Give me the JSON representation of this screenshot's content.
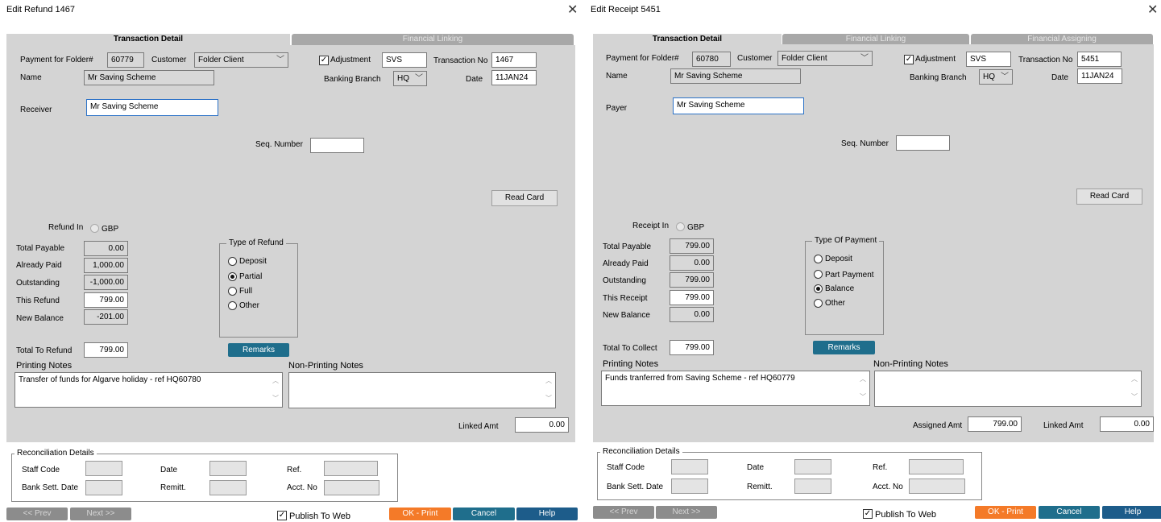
{
  "refund": {
    "title": "Edit Refund 1467",
    "tabs": [
      "Transaction Detail",
      "Financial Linking"
    ],
    "payment_for_folder_label": "Payment for Folder#",
    "folder_no": "60779",
    "customer_label": "Customer",
    "customer_value": "Folder Client",
    "adjustment_label": "Adjustment",
    "adjustment_code": "SVS",
    "transaction_no_label": "Transaction No",
    "transaction_no": "1467",
    "name_label": "Name",
    "name_value": "Mr Saving Scheme",
    "banking_branch_label": "Banking Branch",
    "banking_branch_value": "HQ",
    "date_label": "Date",
    "date_value": "11JAN24",
    "party_label": "Receiver",
    "party_value": "Mr Saving Scheme",
    "seq_number_label": "Seq. Number",
    "seq_number_value": "",
    "read_card_label": "Read Card",
    "currency_in_label": "Refund In",
    "currency": "GBP",
    "amount_rows": [
      {
        "label": "Total Payable",
        "value": "0.00"
      },
      {
        "label": "Already Paid",
        "value": "1,000.00"
      },
      {
        "label": "Outstanding",
        "value": "-1,000.00"
      },
      {
        "label": "This Refund",
        "value": "799.00"
      },
      {
        "label": "New Balance",
        "value": "-201.00"
      }
    ],
    "type_group_title": "Type of Refund",
    "type_options": [
      "Deposit",
      "Partial",
      "Full",
      "Other"
    ],
    "type_selected": "Partial",
    "total_label": "Total To Refund",
    "total_value": "799.00",
    "remarks_label": "Remarks",
    "printing_notes_label": "Printing Notes",
    "printing_notes_value": "Transfer of funds for Algarve holiday - ref HQ60780",
    "non_printing_notes_label": "Non-Printing Notes",
    "non_printing_notes_value": "",
    "linked_amt_label": "Linked Amt",
    "linked_amt_value": "0.00",
    "recon_title": "Reconciliation Details",
    "staff_code_label": "Staff Code",
    "recon_date_label": "Date",
    "ref_label": "Ref.",
    "bank_sett_date_label": "Bank Sett. Date",
    "remitt_label": "Remitt.",
    "acct_no_label": "Acct. No",
    "prev_label": "<< Prev",
    "next_label": "Next >>",
    "publish_label": "Publish To Web",
    "ok_print_label": "OK - Print",
    "cancel_label": "Cancel",
    "help_label": "Help"
  },
  "receipt": {
    "title": "Edit Receipt 5451",
    "tabs": [
      "Transaction Detail",
      "Financial Linking",
      "Financial Assigning"
    ],
    "payment_for_folder_label": "Payment for Folder#",
    "folder_no": "60780",
    "customer_label": "Customer",
    "customer_value": "Folder Client",
    "adjustment_label": "Adjustment",
    "adjustment_code": "SVS",
    "transaction_no_label": "Transaction No",
    "transaction_no": "5451",
    "name_label": "Name",
    "name_value": "Mr Saving Scheme",
    "banking_branch_label": "Banking Branch",
    "banking_branch_value": "HQ",
    "date_label": "Date",
    "date_value": "11JAN24",
    "party_label": "Payer",
    "party_value": "Mr Saving Scheme",
    "seq_number_label": "Seq. Number",
    "seq_number_value": "",
    "read_card_label": "Read Card",
    "currency_in_label": "Receipt In",
    "currency": "GBP",
    "amount_rows": [
      {
        "label": "Total Payable",
        "value": "799.00"
      },
      {
        "label": "Already Paid",
        "value": "0.00"
      },
      {
        "label": "Outstanding",
        "value": "799.00"
      },
      {
        "label": "This Receipt",
        "value": "799.00"
      },
      {
        "label": "New Balance",
        "value": "0.00"
      }
    ],
    "type_group_title": "Type Of Payment",
    "type_options": [
      "Deposit",
      "Part Payment",
      "Balance",
      "Other"
    ],
    "type_selected": "Balance",
    "total_label": "Total To Collect",
    "total_value": "799.00",
    "remarks_label": "Remarks",
    "printing_notes_label": "Printing Notes",
    "printing_notes_value": "Funds tranferred from Saving Scheme - ref HQ60779",
    "non_printing_notes_label": "Non-Printing Notes",
    "non_printing_notes_value": "",
    "assigned_amt_label": "Assigned Amt",
    "assigned_amt_value": "799.00",
    "linked_amt_label": "Linked Amt",
    "linked_amt_value": "0.00",
    "recon_title": "Reconciliation Details",
    "staff_code_label": "Staff Code",
    "recon_date_label": "Date",
    "ref_label": "Ref.",
    "bank_sett_date_label": "Bank Sett. Date",
    "remitt_label": "Remitt.",
    "acct_no_label": "Acct. No",
    "prev_label": "<< Prev",
    "next_label": "Next >>",
    "publish_label": "Publish To Web",
    "ok_print_label": "OK - Print",
    "cancel_label": "Cancel",
    "help_label": "Help"
  },
  "icons": {
    "close": "close-icon",
    "dropdown": "chevron-down-icon",
    "check": "checkmark-icon",
    "scroll_up": "scroll-up-icon",
    "scroll_down": "scroll-down-icon"
  },
  "colors": {
    "panel": "#d4d4d4",
    "tab_inactive": "#a8a8a8",
    "teal_button": "#1f6e8c",
    "ok_button": "#f47a28",
    "navy_button": "#1d5c8a"
  }
}
